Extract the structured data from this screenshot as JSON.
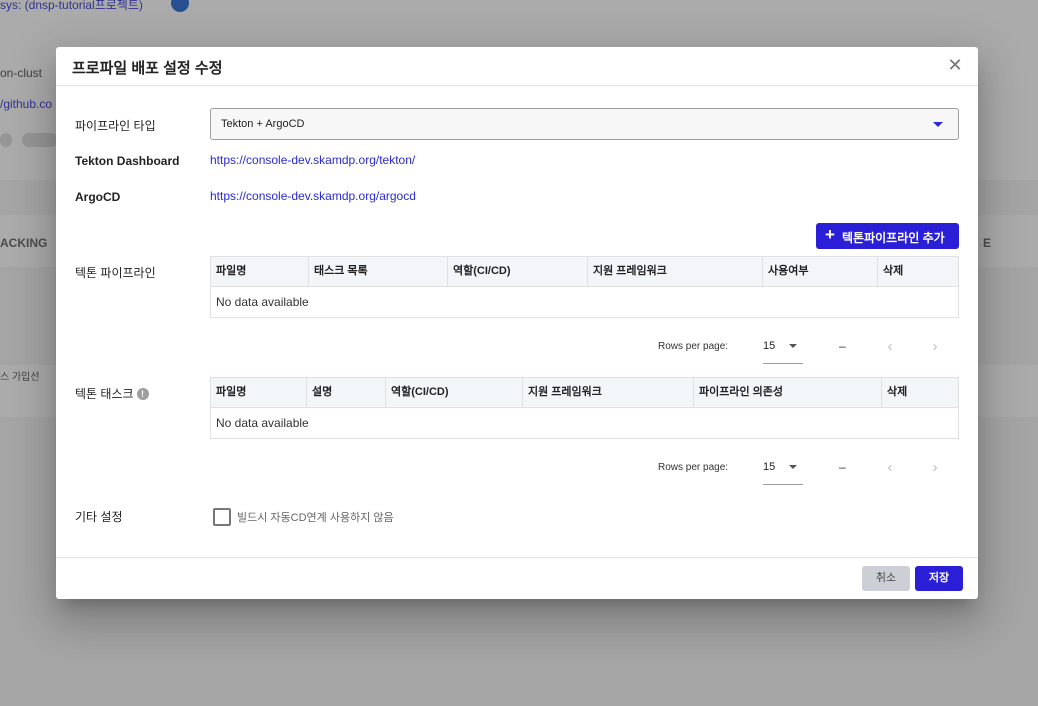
{
  "background": {
    "fragments": [
      "sys: (dnsp-tutorial프로젝트)",
      "on-clust",
      "/github.co",
      "ACKING",
      "E",
      "스 가입선"
    ]
  },
  "dialog": {
    "title": "프로파일 배포 설정 수정",
    "close_icon": "close-icon",
    "pipeline_type": {
      "label": "파이프라인 타입",
      "value": "Tekton + ArgoCD"
    },
    "tekton_dashboard": {
      "label": "Tekton Dashboard",
      "url": "https://console-dev.skamdp.org/tekton/"
    },
    "argocd": {
      "label": "ArgoCD",
      "url": "https://console-dev.skamdp.org/argocd"
    },
    "add_pipeline_button": "+ 텍톤파이프라인 추가",
    "add_pipeline_label": "텍톤파이프라인 추가",
    "tekton_pipeline": {
      "label": "텍톤 파이프라인",
      "columns": [
        "파일명",
        "태스크 목록",
        "역할(CI/CD)",
        "지원 프레임워크",
        "사용여부",
        "삭제"
      ],
      "empty_text": "No data available",
      "pager": {
        "rows_per_page_label": "Rows per page:",
        "rows_per_page": "15",
        "range": "–"
      }
    },
    "tekton_task": {
      "label": "텍톤 태스크",
      "columns": [
        "파일명",
        "설명",
        "역할(CI/CD)",
        "지원 프레임워크",
        "파이프라인 의존성",
        "삭제"
      ],
      "empty_text": "No data available",
      "pager": {
        "rows_per_page_label": "Rows per page:",
        "rows_per_page": "15",
        "range": "–"
      }
    },
    "other_settings": {
      "label": "기타 설정",
      "checkbox_label": "빌드시 자동CD연계 사용하지 않음",
      "checked": false
    },
    "footer": {
      "cancel": "취소",
      "save": "저장"
    }
  },
  "colors": {
    "accent": "#2a1fd6",
    "link": "#2a2ad8",
    "overlay": "rgba(33,33,33,0.38)"
  }
}
